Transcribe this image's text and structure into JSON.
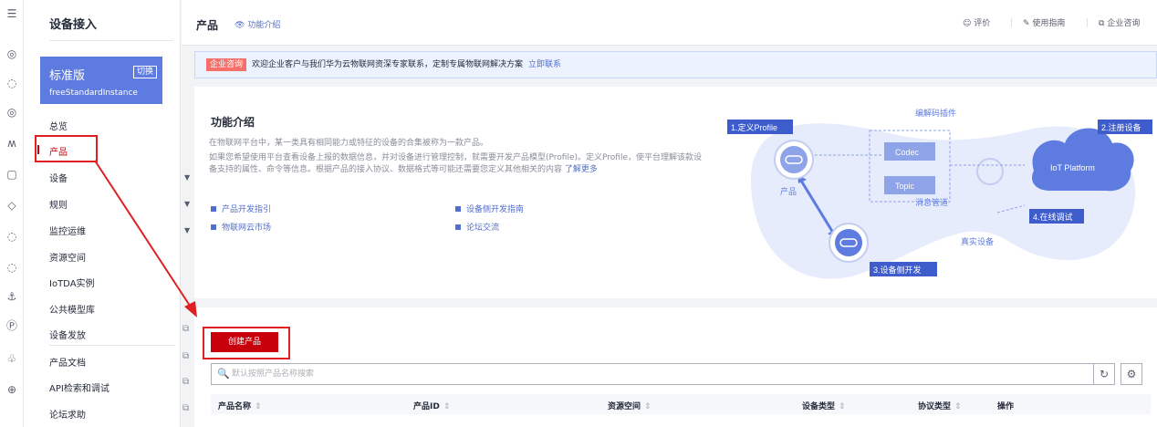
{
  "sidebar": {
    "title": "设备接入",
    "edition": {
      "name": "标准版",
      "instance": "freeStandardInstance",
      "switch_label": "切换"
    },
    "items": [
      {
        "label": "总览"
      },
      {
        "label": "产品"
      },
      {
        "label": "设备"
      },
      {
        "label": "规则"
      },
      {
        "label": "监控运维"
      },
      {
        "label": "资源空间"
      },
      {
        "label": "IoTDA实例"
      },
      {
        "label": "公共模型库"
      },
      {
        "label": "设备发放"
      },
      {
        "label": "产品文档"
      },
      {
        "label": "API检索和调试"
      },
      {
        "label": "论坛求助"
      }
    ]
  },
  "header": {
    "title": "产品",
    "intro_link": "功能介绍",
    "rate": "评价",
    "guide": "使用指南",
    "consult": "企业咨询"
  },
  "banner": {
    "tag": "企业咨询",
    "text": "欢迎企业客户与我们华为云物联网资深专家联系，定制专属物联网解决方案",
    "action": "立即联系"
  },
  "feature": {
    "title": "功能介绍",
    "desc1": "在物联网平台中，某一类具有相同能力或特征的设备的合集被称为一款产品。",
    "desc2": "如果您希望使用平台查看设备上报的数据信息，并对设备进行管理控制，就需要开发产品模型(Profile)。定义Profile，使平台理解该款设备支持的属性、命令等信息。根据产品的接入协议、数据格式等可能还需要您定义其他相关的内容",
    "more": "了解更多",
    "links": [
      "产品开发指引",
      "设备侧开发指南",
      "物联网云市场",
      "论坛交流"
    ]
  },
  "diagram": {
    "step1": "1.定义Profile",
    "step2": "2.注册设备",
    "step3": "3.设备侧开发",
    "step4": "4.在线调试",
    "codec_plugin": "编解码插件",
    "codec": "Codec",
    "topic": "Topic",
    "msg_pipe": "消息管道",
    "product": "产品",
    "real_device": "真实设备",
    "platform": "IoT Platform"
  },
  "list": {
    "create_button": "创建产品",
    "search_placeholder": "默认按照产品名称搜索",
    "columns": [
      "产品名称",
      "产品ID",
      "资源空间",
      "设备类型",
      "协议类型",
      "操作"
    ]
  },
  "colors": {
    "accent": "#c7000b",
    "brand": "#5e7ce0",
    "link": "#526ecc",
    "annotation": "#e02020"
  }
}
